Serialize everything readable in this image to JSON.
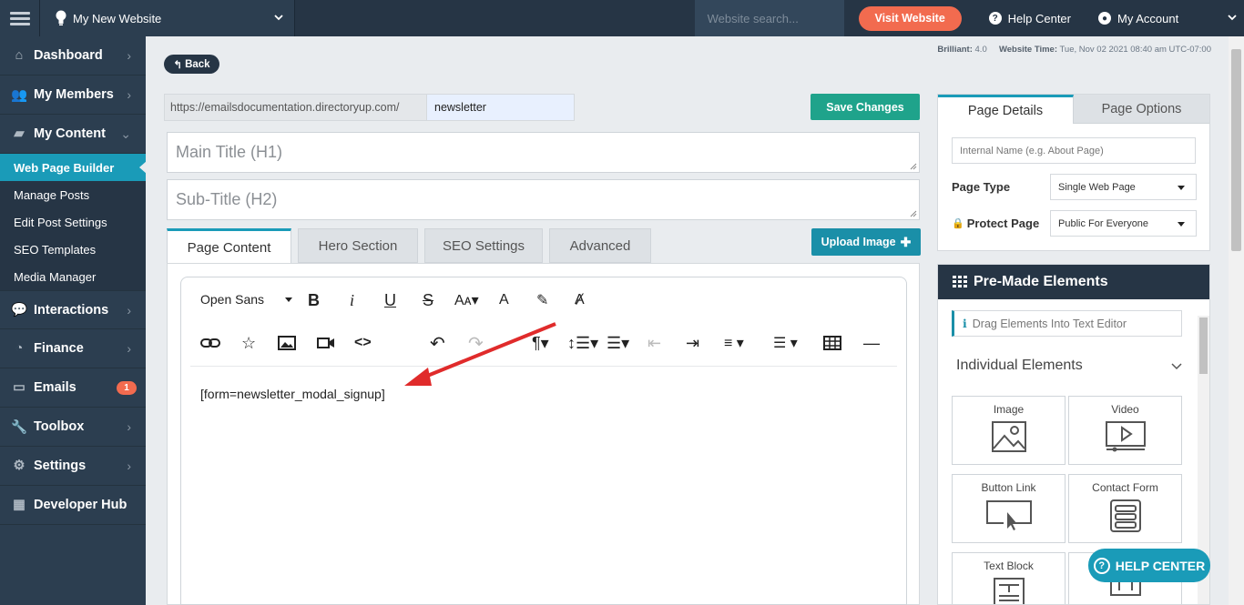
{
  "topbar": {
    "site_name": "My New Website",
    "search_placeholder": "Website search...",
    "visit_label": "Visit Website",
    "help_label": "Help Center",
    "account_label": "My Account"
  },
  "sidebar": {
    "items": [
      {
        "label": "Dashboard"
      },
      {
        "label": "My Members"
      },
      {
        "label": "My Content"
      },
      {
        "label": "Interactions"
      },
      {
        "label": "Finance"
      },
      {
        "label": "Emails",
        "badge": "1"
      },
      {
        "label": "Toolbox"
      },
      {
        "label": "Settings"
      },
      {
        "label": "Developer Hub"
      }
    ],
    "sub_items": [
      {
        "label": "Web Page Builder"
      },
      {
        "label": "Manage Posts"
      },
      {
        "label": "Edit Post Settings"
      },
      {
        "label": "SEO Templates"
      },
      {
        "label": "Media Manager"
      }
    ]
  },
  "meta": {
    "version_label": "Brilliant:",
    "version_value": "4.0",
    "time_label": "Website Time:",
    "time_value": "Tue, Nov 02 2021 08:40 am UTC-07:00"
  },
  "page": {
    "back_label": "Back",
    "url_prefix": "https://emailsdocumentation.directoryup.com/",
    "url_slug": "newsletter",
    "save_label": "Save Changes",
    "main_title_placeholder": "Main Title (H1)",
    "sub_title_placeholder": "Sub-Title (H2)",
    "upload_label": "Upload Image",
    "tabs": [
      {
        "label": "Page Content"
      },
      {
        "label": "Hero Section"
      },
      {
        "label": "SEO Settings"
      },
      {
        "label": "Advanced"
      }
    ]
  },
  "editor": {
    "font": "Open Sans",
    "content": "[form=newsletter_modal_signup]"
  },
  "page_details": {
    "tabs": [
      {
        "label": "Page Details"
      },
      {
        "label": "Page Options"
      }
    ],
    "internal_name_placeholder": "Internal Name (e.g. About Page)",
    "page_type_label": "Page Type",
    "page_type_value": "Single Web Page",
    "protect_label": "Protect Page",
    "protect_value": "Public For Everyone"
  },
  "premade": {
    "title": "Pre-Made Elements",
    "drag_hint": "Drag Elements Into Text Editor",
    "section_label": "Individual Elements",
    "elements": [
      {
        "label": "Image"
      },
      {
        "label": "Video"
      },
      {
        "label": "Button Link"
      },
      {
        "label": "Contact Form"
      },
      {
        "label": "Text Block"
      },
      {
        "label": ""
      }
    ]
  },
  "help_center_label": "HELP CENTER",
  "colors": {
    "nav_bg": "#2c3e50",
    "accent": "#1a9bb8",
    "save_green": "#1fa38b",
    "visit_orange": "#f26b4f",
    "annotation_arrow": "#e02b2b"
  }
}
